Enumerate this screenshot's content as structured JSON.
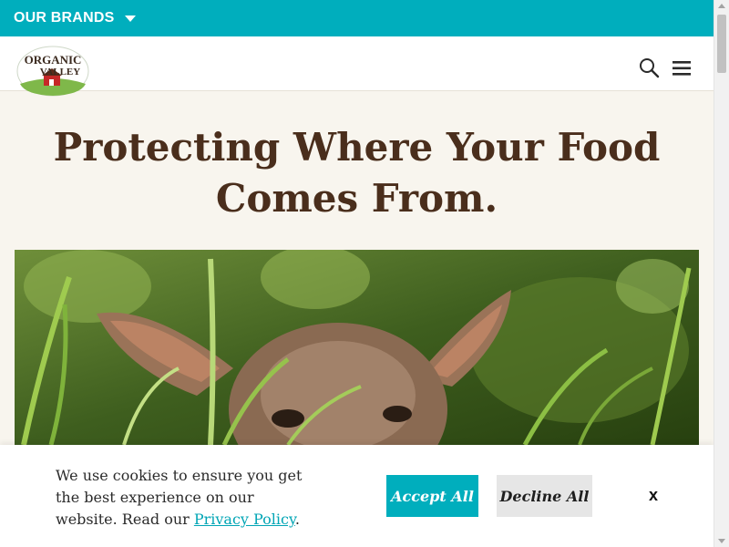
{
  "brands_bar": {
    "label": "OUR BRANDS",
    "caret_icon": "caret-down-icon"
  },
  "header": {
    "logo": {
      "line1": "ORGANIC",
      "line2": "VALLEY"
    },
    "search_icon": "search-icon",
    "menu_icon": "hamburger-menu-icon"
  },
  "hero": {
    "title_line1": "Protecting Where Your Food",
    "title_line2": "Comes From."
  },
  "cookie_banner": {
    "text_before_link": "We use cookies to ensure you get the best experience on our website. Read our ",
    "link_text": "Privacy Policy",
    "text_after_link": ".",
    "accept_label": "Accept All",
    "decline_label": "Decline All",
    "close_label": "x"
  },
  "colors": {
    "teal": "#00aebd",
    "title_brown": "#4a2e1c",
    "cream": "#f8f5ee"
  }
}
